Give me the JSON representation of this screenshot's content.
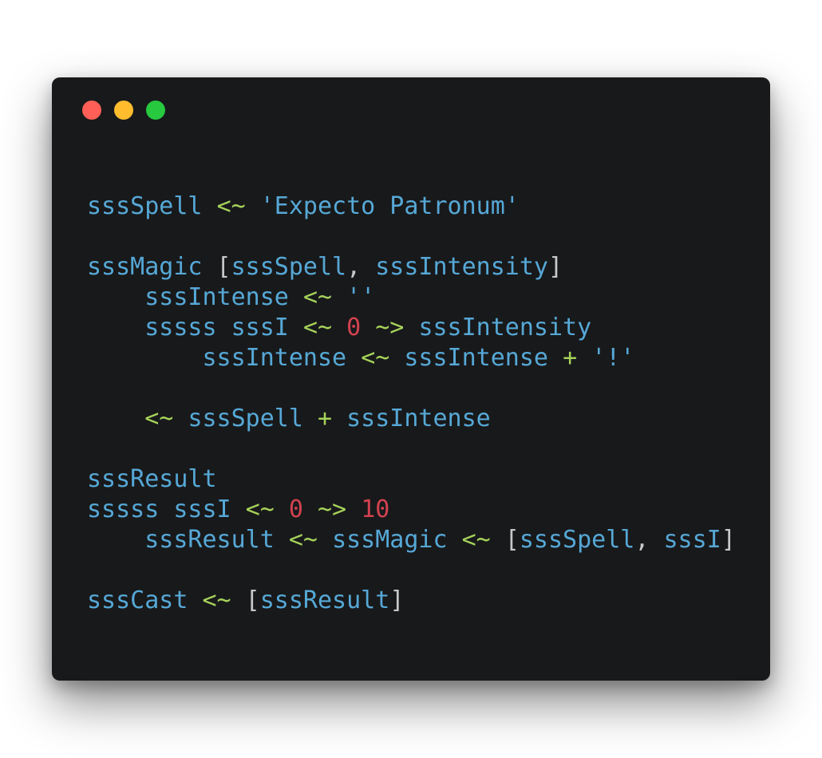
{
  "window_controls": {
    "close_color": "#ff5f56",
    "minimize_color": "#ffbd2e",
    "maximize_color": "#27c93f"
  },
  "colors": {
    "background": "#18191b",
    "identifier": "#56a8d6",
    "operator": "#a6d35a",
    "number": "#d2424f",
    "punctuation": "#c8c8c8"
  },
  "code_lines": [
    [
      [
        "ident",
        "sssSpell"
      ],
      [
        "punc",
        " "
      ],
      [
        "op",
        "<~"
      ],
      [
        "punc",
        " "
      ],
      [
        "str",
        "'Expecto Patronum'"
      ]
    ],
    [],
    [
      [
        "ident",
        "sssMagic"
      ],
      [
        "punc",
        " ["
      ],
      [
        "ident",
        "sssSpell"
      ],
      [
        "punc",
        ", "
      ],
      [
        "ident",
        "sssIntensity"
      ],
      [
        "punc",
        "]"
      ]
    ],
    [
      [
        "punc",
        "    "
      ],
      [
        "ident",
        "sssIntense"
      ],
      [
        "punc",
        " "
      ],
      [
        "op",
        "<~"
      ],
      [
        "punc",
        " "
      ],
      [
        "str",
        "''"
      ]
    ],
    [
      [
        "punc",
        "    "
      ],
      [
        "ident",
        "sssss"
      ],
      [
        "punc",
        " "
      ],
      [
        "ident",
        "sssI"
      ],
      [
        "punc",
        " "
      ],
      [
        "op",
        "<~"
      ],
      [
        "punc",
        " "
      ],
      [
        "num",
        "0"
      ],
      [
        "punc",
        " "
      ],
      [
        "op",
        "~>"
      ],
      [
        "punc",
        " "
      ],
      [
        "ident",
        "sssIntensity"
      ]
    ],
    [
      [
        "punc",
        "        "
      ],
      [
        "ident",
        "sssIntense"
      ],
      [
        "punc",
        " "
      ],
      [
        "op",
        "<~"
      ],
      [
        "punc",
        " "
      ],
      [
        "ident",
        "sssIntense"
      ],
      [
        "punc",
        " "
      ],
      [
        "op",
        "+"
      ],
      [
        "punc",
        " "
      ],
      [
        "str",
        "'!'"
      ]
    ],
    [],
    [
      [
        "punc",
        "    "
      ],
      [
        "op",
        "<~"
      ],
      [
        "punc",
        " "
      ],
      [
        "ident",
        "sssSpell"
      ],
      [
        "punc",
        " "
      ],
      [
        "op",
        "+"
      ],
      [
        "punc",
        " "
      ],
      [
        "ident",
        "sssIntense"
      ]
    ],
    [],
    [
      [
        "ident",
        "sssResult"
      ]
    ],
    [
      [
        "ident",
        "sssss"
      ],
      [
        "punc",
        " "
      ],
      [
        "ident",
        "sssI"
      ],
      [
        "punc",
        " "
      ],
      [
        "op",
        "<~"
      ],
      [
        "punc",
        " "
      ],
      [
        "num",
        "0"
      ],
      [
        "punc",
        " "
      ],
      [
        "op",
        "~>"
      ],
      [
        "punc",
        " "
      ],
      [
        "num",
        "10"
      ]
    ],
    [
      [
        "punc",
        "    "
      ],
      [
        "ident",
        "sssResult"
      ],
      [
        "punc",
        " "
      ],
      [
        "op",
        "<~"
      ],
      [
        "punc",
        " "
      ],
      [
        "ident",
        "sssMagic"
      ],
      [
        "punc",
        " "
      ],
      [
        "op",
        "<~"
      ],
      [
        "punc",
        " ["
      ],
      [
        "ident",
        "sssSpell"
      ],
      [
        "punc",
        ", "
      ],
      [
        "ident",
        "sssI"
      ],
      [
        "punc",
        "]"
      ]
    ],
    [],
    [
      [
        "ident",
        "sssCast"
      ],
      [
        "punc",
        " "
      ],
      [
        "op",
        "<~"
      ],
      [
        "punc",
        " ["
      ],
      [
        "ident",
        "sssResult"
      ],
      [
        "punc",
        "]"
      ]
    ]
  ]
}
